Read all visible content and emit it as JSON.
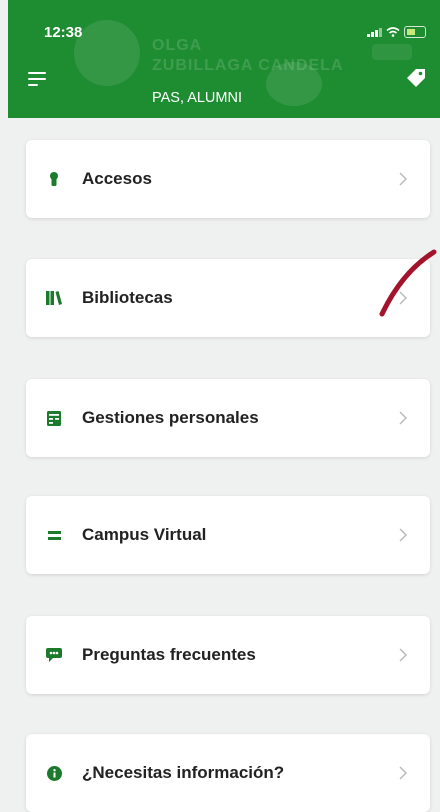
{
  "status_bar": {
    "time": "12:38"
  },
  "header": {
    "name_line1": "OLGA",
    "name_line2": "ZUBILLAGA CANDELA",
    "roles": "PAS, ALUMNI"
  },
  "menu": [
    {
      "label": "Accesos",
      "icon": "keyhole-icon"
    },
    {
      "label": "Bibliotecas",
      "icon": "books-icon"
    },
    {
      "label": "Gestiones personales",
      "icon": "ledger-icon"
    },
    {
      "label": "Campus Virtual",
      "icon": "equals-icon"
    },
    {
      "label": "Preguntas frecuentes",
      "icon": "speech-bubble-icon"
    },
    {
      "label": "¿Necesitas información?",
      "icon": "info-icon"
    }
  ],
  "colors": {
    "header_bg": "#1e8c31",
    "icon_green": "#1b7a2c",
    "background": "#eff0f0",
    "annotation": "#a3132b"
  }
}
